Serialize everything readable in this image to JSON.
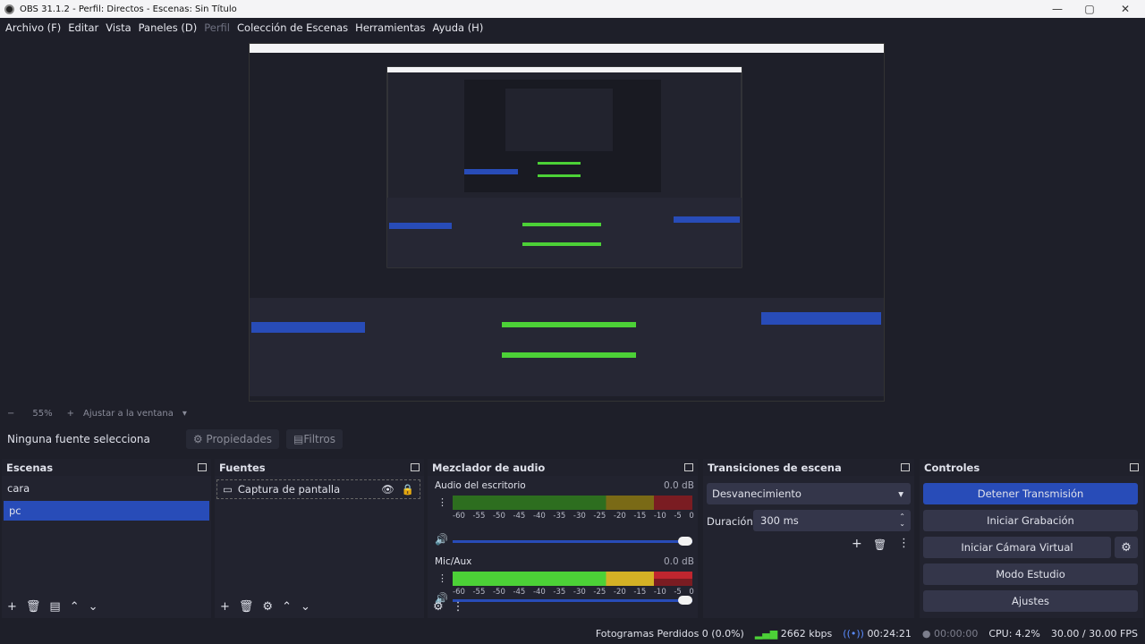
{
  "window": {
    "title": "OBS 31.1.2 - Perfil: Directos - Escenas: Sin Título"
  },
  "menu": {
    "items": [
      "Archivo (F)",
      "Editar",
      "Vista",
      "Paneles (D)",
      "Perfil",
      "Colección de Escenas",
      "Herramientas",
      "Ayuda (H)"
    ]
  },
  "zoom": {
    "minus": "−",
    "value": "55%",
    "plus": "+",
    "fit": "Ajustar a la ventana"
  },
  "source_bar": {
    "none": "Ninguna fuente selecciona",
    "props": "Propiedades",
    "filters": "Filtros"
  },
  "scenes": {
    "title": "Escenas",
    "items": [
      "cara",
      "pc"
    ],
    "selected": 1
  },
  "sources": {
    "title": "Fuentes",
    "items": [
      "Captura de pantalla"
    ]
  },
  "mixer": {
    "title": "Mezclador de audio",
    "channels": [
      {
        "name": "Audio del escritorio",
        "db": "0.0 dB",
        "level": 0.9
      },
      {
        "name": "Mic/Aux",
        "db": "0.0 dB",
        "level": 0.95
      }
    ],
    "scale": [
      "-60",
      "-55",
      "-50",
      "-45",
      "-40",
      "-35",
      "-30",
      "-25",
      "-20",
      "-15",
      "-10",
      "-5",
      "0"
    ]
  },
  "transitions": {
    "title": "Transiciones de escena",
    "type": "Desvanecimiento",
    "duration_label": "Duración",
    "duration_value": "300 ms"
  },
  "controls": {
    "title": "Controles",
    "stop_stream": "Detener Transmisión",
    "start_rec": "Iniciar Grabación",
    "virtual_cam": "Iniciar Cámara Virtual",
    "studio": "Modo Estudio",
    "settings": "Ajustes"
  },
  "status": {
    "dropped": "Fotogramas Perdidos 0 (0.0%)",
    "kbps": "2662 kbps",
    "stream_time": "00:24:21",
    "rec_time": "00:00:00",
    "cpu": "CPU: 4.2%",
    "fps": "30.00 / 30.00 FPS"
  },
  "colors": {
    "accent": "#284cb8",
    "meter_green": "#4cd137",
    "meter_yellow": "#d4b125",
    "meter_red": "#c0262f"
  }
}
